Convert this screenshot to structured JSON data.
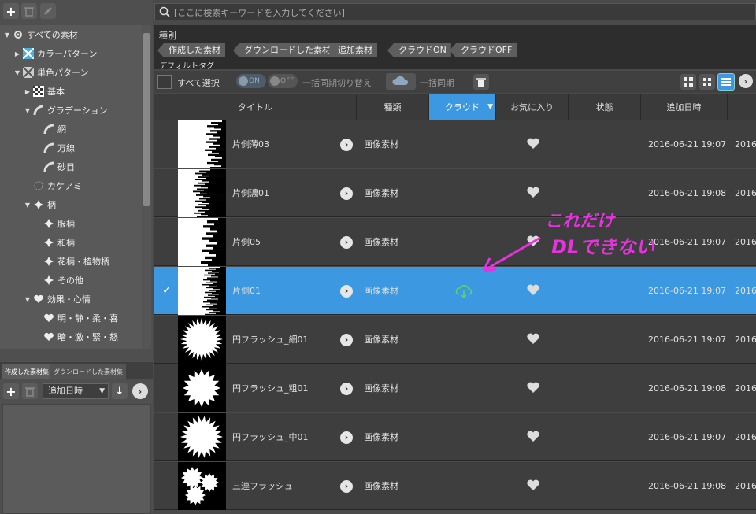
{
  "left": {
    "tree": [
      {
        "label": "すべての素材",
        "level": 0,
        "arrow": "down",
        "icon": "circle-icon"
      },
      {
        "label": "カラーパターン",
        "level": 1,
        "arrow": "right",
        "icon": "color-pattern-icon"
      },
      {
        "label": "単色パターン",
        "level": 1,
        "arrow": "down",
        "icon": "mono-pattern-icon"
      },
      {
        "label": "基本",
        "level": 2,
        "arrow": "right",
        "icon": "checker-icon"
      },
      {
        "label": "グラデーション",
        "level": 2,
        "arrow": "down",
        "icon": "gradation-icon"
      },
      {
        "label": "網",
        "level": 3,
        "arrow": "",
        "icon": "gradation-icon"
      },
      {
        "label": "万線",
        "level": 3,
        "arrow": "",
        "icon": "gradation-icon"
      },
      {
        "label": "砂目",
        "level": 3,
        "arrow": "",
        "icon": "gradation-icon"
      },
      {
        "label": "カケアミ",
        "level": 2,
        "arrow": "",
        "icon": "dots-icon"
      },
      {
        "label": "柄",
        "level": 2,
        "arrow": "down",
        "icon": "pattern-icon"
      },
      {
        "label": "服柄",
        "level": 3,
        "arrow": "",
        "icon": "pattern-icon"
      },
      {
        "label": "和柄",
        "level": 3,
        "arrow": "",
        "icon": "pattern-icon"
      },
      {
        "label": "花柄・植物柄",
        "level": 3,
        "arrow": "",
        "icon": "pattern-icon"
      },
      {
        "label": "その他",
        "level": 3,
        "arrow": "",
        "icon": "pattern-icon"
      },
      {
        "label": "効果・心情",
        "level": 2,
        "arrow": "down",
        "icon": "heart-icon"
      },
      {
        "label": "明・静・柔・喜",
        "level": 3,
        "arrow": "",
        "icon": "heart-icon"
      },
      {
        "label": "暗・激・緊・怒",
        "level": 3,
        "arrow": "",
        "icon": "heart-icon"
      }
    ],
    "tabs": [
      "作成した素材集",
      "ダウンロードした素材集"
    ],
    "sort_label": "追加日時"
  },
  "search": {
    "placeholder": "[ここに検索キーワードを入力してください]"
  },
  "filters": {
    "heading": "種別",
    "chips": [
      "作成した素材",
      "ダウンロードした素材",
      "追加素材",
      "クラウドON",
      "クラウドOFF"
    ],
    "tag_heading": "デフォルトタグ"
  },
  "toolbar": {
    "select_all": "すべて選択",
    "sync_on": "ON",
    "sync_off": "OFF",
    "sync_toggle_label": "一括同期切り替え",
    "sync_all_label": "一括同期"
  },
  "columns": [
    "タイトル",
    "種類",
    "クラウド",
    "お気に入り",
    "状態",
    "追加日時",
    ""
  ],
  "rows": [
    {
      "title": "片側薄03",
      "kind": "画像素材",
      "date": "2016-06-21 19:07",
      "date2": "2016",
      "selected": false,
      "cloud": false
    },
    {
      "title": "片側濃01",
      "kind": "画像素材",
      "date": "2016-06-21 19:08",
      "date2": "2016",
      "selected": false,
      "cloud": false
    },
    {
      "title": "片側05",
      "kind": "画像素材",
      "date": "2016-06-21 19:07",
      "date2": "2016",
      "selected": false,
      "cloud": false
    },
    {
      "title": "片側01",
      "kind": "画像素材",
      "date": "2016-06-21 19:07",
      "date2": "2016",
      "selected": true,
      "cloud": true
    },
    {
      "title": "円フラッシュ_細01",
      "kind": "画像素材",
      "date": "2016-06-21 19:07",
      "date2": "2016",
      "selected": false,
      "cloud": false
    },
    {
      "title": "円フラッシュ_粗01",
      "kind": "画像素材",
      "date": "2016-06-21 19:08",
      "date2": "2016",
      "selected": false,
      "cloud": false
    },
    {
      "title": "円フラッシュ_中01",
      "kind": "画像素材",
      "date": "2016-06-21 19:07",
      "date2": "2016",
      "selected": false,
      "cloud": false
    },
    {
      "title": "三連フラッシュ",
      "kind": "画像素材",
      "date": "2016-06-21 19:08",
      "date2": "2016",
      "selected": false,
      "cloud": false
    }
  ],
  "annotation": {
    "line1": "これだけ",
    "line2": "DLできない",
    "color": "#e832e0"
  },
  "colors": {
    "accent": "#3c98e0",
    "cloud_icon": "#5bd46a"
  }
}
